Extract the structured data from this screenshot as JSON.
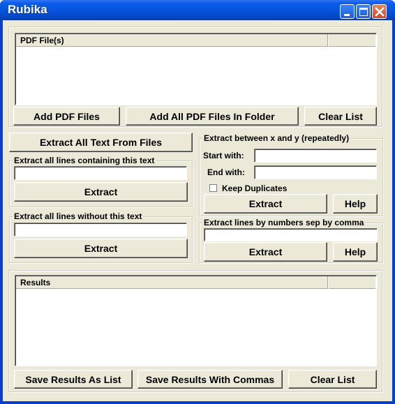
{
  "window": {
    "title": "Rubika",
    "controls": {
      "minimize": "minimize-icon",
      "maximize": "maximize-icon",
      "close": "close-icon"
    },
    "colors": {
      "titlebar": "#0655de",
      "face": "#ece9d8",
      "close": "#c9482b"
    }
  },
  "files_panel": {
    "list_header": "PDF File(s)",
    "add_files_label": "Add PDF Files",
    "add_folder_label": "Add All PDF Files In Folder",
    "clear_label": "Clear List"
  },
  "extract_all": {
    "label": "Extract All Text From Files"
  },
  "containing": {
    "group_label": "Extract all lines containing this text",
    "input_value": "",
    "button_label": "Extract"
  },
  "without": {
    "group_label": "Extract all lines without this text",
    "input_value": "",
    "button_label": "Extract"
  },
  "between": {
    "group_label": "Extract between x and y (repeatedly)",
    "start_label": "Start with:",
    "start_value": "",
    "end_label": "End with:",
    "end_value": "",
    "keep_duplicates_label": "Keep Duplicates",
    "keep_duplicates_checked": false,
    "extract_label": "Extract",
    "help_label": "Help"
  },
  "by_numbers": {
    "group_label": "Extract lines by numbers sep by comma",
    "input_value": "",
    "extract_label": "Extract",
    "help_label": "Help"
  },
  "results_panel": {
    "list_header": "Results",
    "save_list_label": "Save Results As List",
    "save_commas_label": "Save Results With Commas",
    "clear_label": "Clear List"
  }
}
